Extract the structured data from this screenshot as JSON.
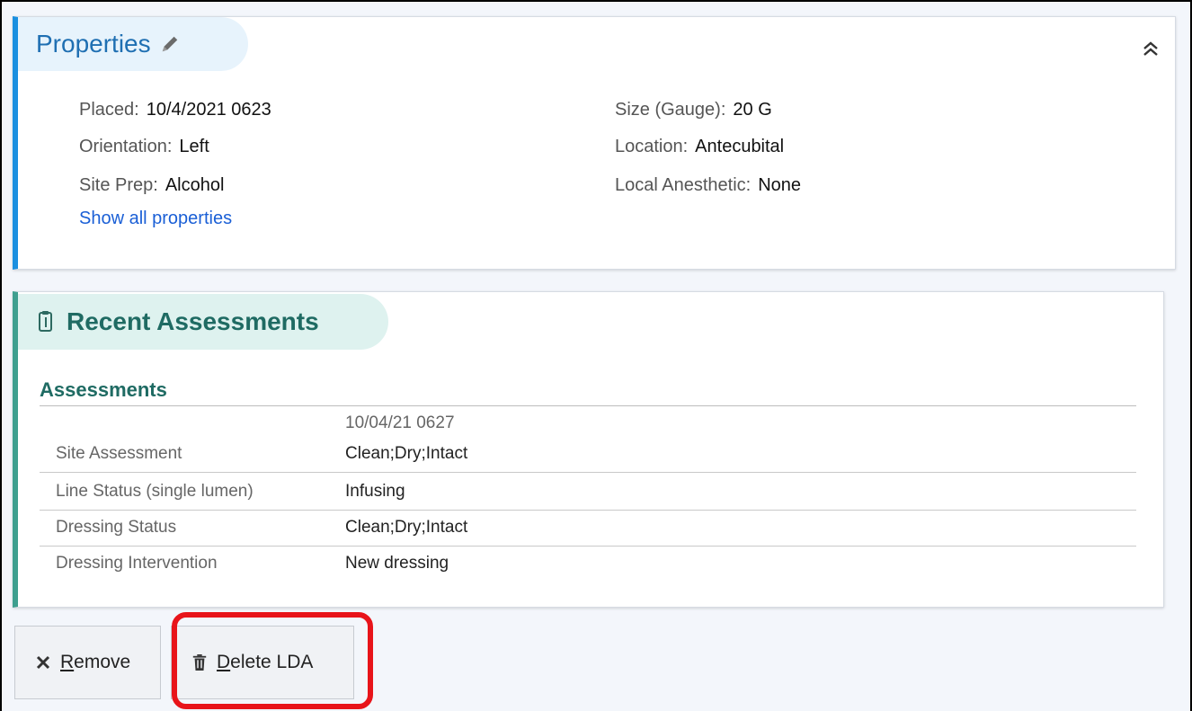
{
  "properties": {
    "title": "Properties",
    "show_all_label": "Show all properties",
    "left": [
      {
        "label": "Placed:",
        "value": "10/4/2021  0623"
      },
      {
        "label": "Orientation:",
        "value": "Left"
      },
      {
        "label": "Site Prep:",
        "value": "Alcohol"
      }
    ],
    "right": [
      {
        "label": "Size (Gauge):",
        "value": "20 G"
      },
      {
        "label": "Location:",
        "value": "Antecubital"
      },
      {
        "label": "Local Anesthetic:",
        "value": "None"
      }
    ]
  },
  "assessments": {
    "title": "Recent Assessments",
    "subhead": "Assessments",
    "date": "10/04/21 0627",
    "rows": [
      {
        "label": "Site Assessment",
        "value": "Clean;Dry;Intact"
      },
      {
        "label": "Line Status (single lumen)",
        "value": "Infusing"
      },
      {
        "label": "Dressing Status",
        "value": "Clean;Dry;Intact"
      },
      {
        "label": "Dressing Intervention",
        "value": "New dressing"
      }
    ]
  },
  "footer": {
    "remove_first": "R",
    "remove_rest": "emove",
    "delete_first": "D",
    "delete_rest": "elete LDA"
  },
  "colors": {
    "properties_accent": "#1a8fe0",
    "assessments_accent": "#3e9f8f",
    "highlight": "#e8141a"
  }
}
